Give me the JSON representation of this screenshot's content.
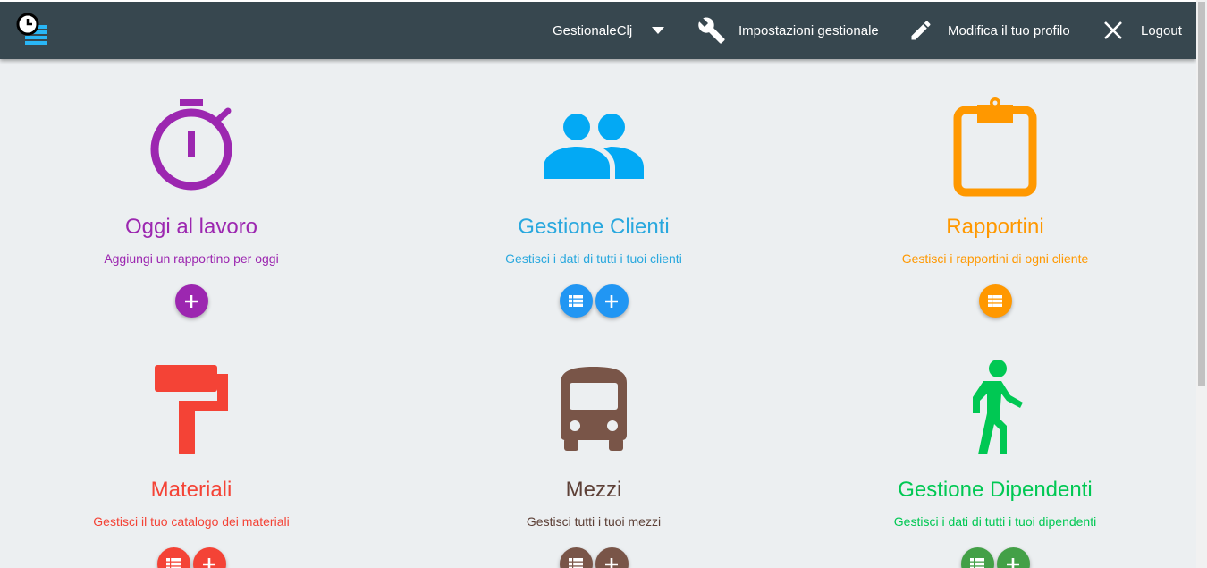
{
  "header": {
    "org_dropdown": "GestionaleClj",
    "settings_label": "Impostazioni gestionale",
    "profile_label": "Modifica il tuo profilo",
    "logout_label": "Logout"
  },
  "colors": {
    "topbar": "#37474f",
    "purple": "#9c27b0",
    "light_blue": "#03a9f4",
    "blue": "#2196f3",
    "orange": "#ff9800",
    "red": "#f44336",
    "brown": "#795548",
    "green": "#00c853",
    "green_fab": "#43a047"
  },
  "cards": [
    {
      "title": "Oggi al lavoro",
      "subtitle": "Aggiungi un rapportino per oggi",
      "icon": "stopwatch-icon",
      "actions": [
        "add"
      ]
    },
    {
      "title": "Gestione Clienti",
      "subtitle": "Gestisci i dati di tutti i tuoi clienti",
      "icon": "people-icon",
      "actions": [
        "list",
        "add"
      ]
    },
    {
      "title": "Rapportini",
      "subtitle": "Gestisci i rapportini di ogni cliente",
      "icon": "clipboard-icon",
      "actions": [
        "list"
      ]
    },
    {
      "title": "Materiali",
      "subtitle": "Gestisci il tuo catalogo dei materiali",
      "icon": "paint-roller-icon",
      "actions": [
        "list",
        "add"
      ]
    },
    {
      "title": "Mezzi",
      "subtitle": "Gestisci tutti i tuoi mezzi",
      "icon": "bus-icon",
      "actions": [
        "list",
        "add"
      ]
    },
    {
      "title": "Gestione Dipendenti",
      "subtitle": "Gestisci i dati di tutti i tuoi dipendenti",
      "icon": "walking-person-icon",
      "actions": [
        "list",
        "add"
      ]
    }
  ]
}
